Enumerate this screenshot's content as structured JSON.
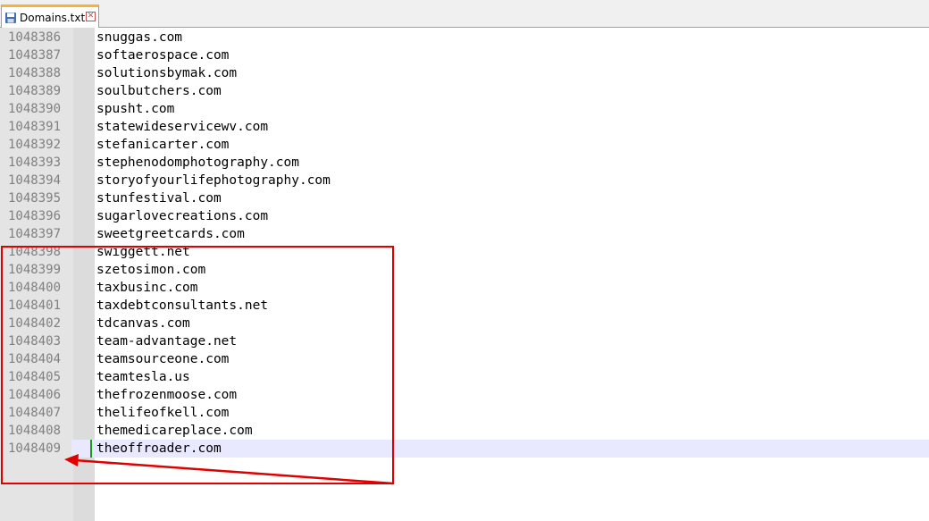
{
  "tab": {
    "label": "Domains.txt",
    "icon": "save-file-icon",
    "close_icon": "close-icon",
    "accent": "#f9b233"
  },
  "annotation_color": "#e00000",
  "editor": {
    "lines": [
      {
        "number": "1048386",
        "text": "snuggas.com"
      },
      {
        "number": "1048387",
        "text": "softaerospace.com"
      },
      {
        "number": "1048388",
        "text": "solutionsbymak.com"
      },
      {
        "number": "1048389",
        "text": "soulbutchers.com"
      },
      {
        "number": "1048390",
        "text": "spusht.com"
      },
      {
        "number": "1048391",
        "text": "statewideservicewv.com"
      },
      {
        "number": "1048392",
        "text": "stefanicarter.com"
      },
      {
        "number": "1048393",
        "text": "stephenodomphotography.com"
      },
      {
        "number": "1048394",
        "text": "storyofyourlifephotography.com"
      },
      {
        "number": "1048395",
        "text": "stunfestival.com"
      },
      {
        "number": "1048396",
        "text": "sugarlovecreations.com"
      },
      {
        "number": "1048397",
        "text": "sweetgreetcards.com"
      },
      {
        "number": "1048398",
        "text": "swiggett.net"
      },
      {
        "number": "1048399",
        "text": "szetosimon.com"
      },
      {
        "number": "1048400",
        "text": "taxbusinc.com"
      },
      {
        "number": "1048401",
        "text": "taxdebtconsultants.net"
      },
      {
        "number": "1048402",
        "text": "tdcanvas.com"
      },
      {
        "number": "1048403",
        "text": "team-advantage.net"
      },
      {
        "number": "1048404",
        "text": "teamsourceone.com"
      },
      {
        "number": "1048405",
        "text": "teamtesla.us"
      },
      {
        "number": "1048406",
        "text": "thefrozenmoose.com"
      },
      {
        "number": "1048407",
        "text": "thelifeofkell.com"
      },
      {
        "number": "1048408",
        "text": "themedicareplace.com"
      },
      {
        "number": "1048409",
        "text": "theoffroader.com"
      }
    ]
  }
}
